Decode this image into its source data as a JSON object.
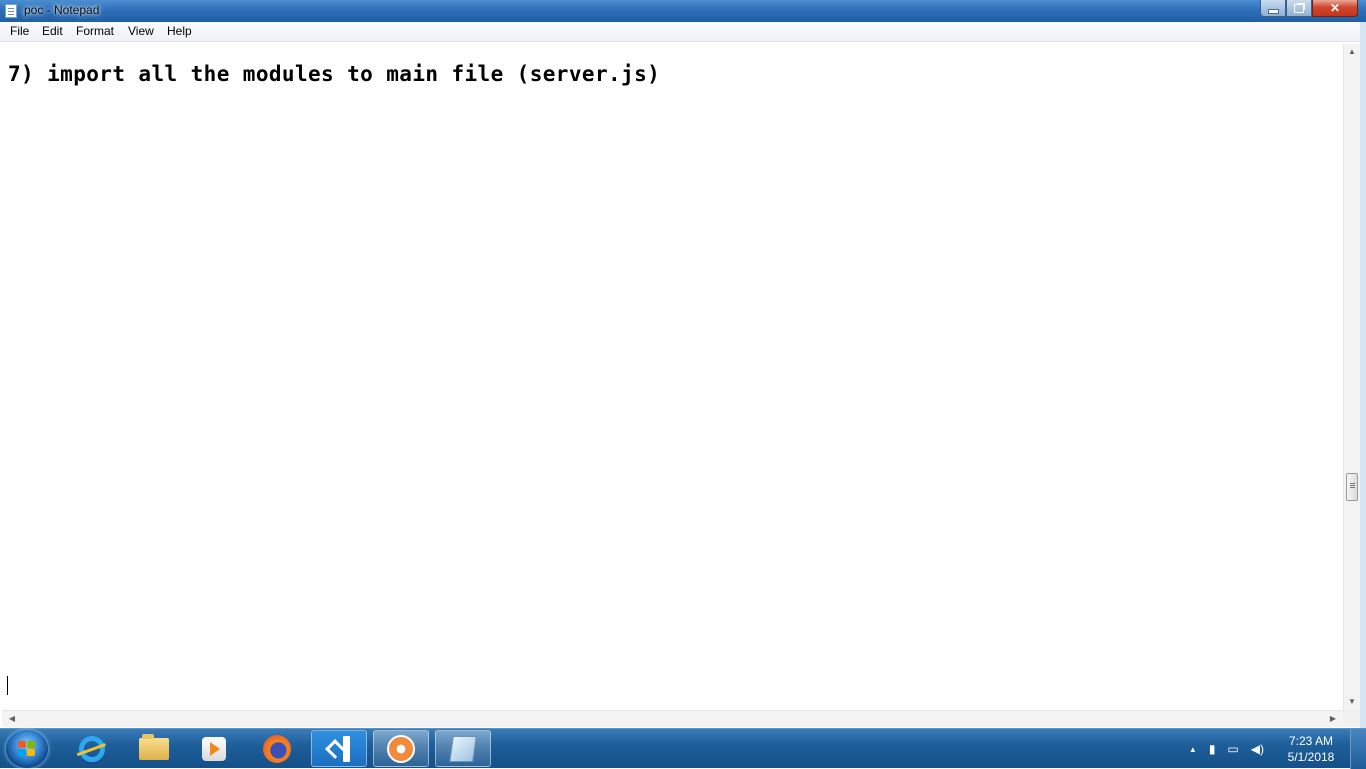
{
  "window": {
    "title": "poc - Notepad"
  },
  "menu": {
    "items": [
      "File",
      "Edit",
      "Format",
      "View",
      "Help"
    ]
  },
  "editor": {
    "content": "7) import all the modules to main file (server.js)"
  },
  "scrollbar": {
    "up": "▲",
    "down": "▼",
    "left": "◀",
    "right": "▶"
  },
  "taskbar": {
    "apps": [
      "internet-explorer",
      "file-explorer",
      "media-player",
      "firefox",
      "visual-studio-code",
      "flower-app",
      "notepad"
    ],
    "tray": {
      "arrow": "▲"
    },
    "clock": {
      "time": "7:23 AM",
      "date": "5/1/2018"
    }
  },
  "colors": {
    "titlebar": "#2d6fb8",
    "taskbar": "#1f5f9a",
    "close": "#d3462d"
  }
}
